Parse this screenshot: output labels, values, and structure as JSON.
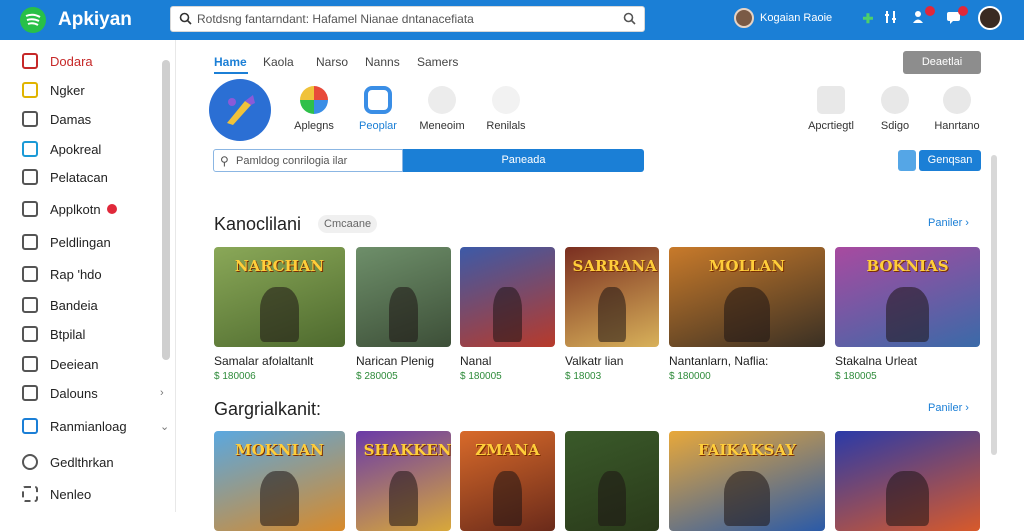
{
  "header": {
    "app_title": "Apkiyan",
    "search_placeholder": "Rotdsng fantarndant: Hafamel Nianae dntanacefiata",
    "user_name": "Kogaian Raoie",
    "icons": [
      "spotify-logo-icon",
      "search-icon",
      "plus-icon",
      "filter-icon",
      "notifications-icon",
      "messages-icon"
    ]
  },
  "sidebar": {
    "items": [
      {
        "label": "Dodara",
        "icon": "home-icon",
        "active": true
      },
      {
        "label": "Ngker",
        "icon": "star-icon"
      },
      {
        "label": "Damas",
        "icon": "list-icon"
      },
      {
        "label": "Apokreal",
        "icon": "app-icon"
      },
      {
        "label": "Pelatacan",
        "icon": "grid-icon"
      },
      {
        "label": "Applkotn",
        "icon": "tag-icon",
        "badge": true
      },
      {
        "label": "Peldlingan",
        "icon": "list-icon"
      },
      {
        "label": "Rap 'hdo",
        "icon": "folder-icon"
      },
      {
        "label": "Bandeia",
        "icon": "folder-icon"
      },
      {
        "label": "Btpilal",
        "icon": "folder-icon"
      },
      {
        "label": "Deeiean",
        "icon": "folder-icon"
      },
      {
        "label": "Dalouns",
        "icon": "stack-icon",
        "chevron": "›"
      },
      {
        "label": "Ranmianloag",
        "icon": "download-icon",
        "chevron": "⌄"
      },
      {
        "label": "Gedlthrkan",
        "icon": "clock-icon"
      },
      {
        "label": "Nenleo",
        "icon": "settings-icon"
      }
    ]
  },
  "tabs": [
    "Hame",
    "Kaola",
    "Narso",
    "Nanns",
    "Samers"
  ],
  "action_button": "Deaetlai",
  "categories_left": [
    {
      "label": "Aplegns",
      "color": "#e8a33b"
    },
    {
      "label": "Peoplar",
      "color": "#3a8ee6",
      "active": true
    },
    {
      "label": "Meneoim",
      "color": "#6d6d6d"
    },
    {
      "label": "Renilals",
      "color": "#5a6f8a"
    }
  ],
  "categories_right": [
    {
      "label": "Apcrtiegtl",
      "color": "#707070"
    },
    {
      "label": "Sdigo",
      "color": "#8a8a8a"
    },
    {
      "label": "Hanrtano",
      "color": "#8a8a8a"
    }
  ],
  "filter": {
    "placeholder": "Pamldog conrilogia ilar",
    "button_label": "Paneada",
    "right_button_label": "Genqsan"
  },
  "sections": [
    {
      "title": "Kanoclilani",
      "tag": "Cmcaane",
      "see_all": "Paniler ›",
      "cards": [
        {
          "title": "Samalar afolaltanlt",
          "price": "$ 180006",
          "art": "NARCHAN",
          "colors": [
            "#8aa858",
            "#4e6a2e"
          ]
        },
        {
          "title": "Narican Plenig",
          "price": "$ 280005",
          "art": "",
          "colors": [
            "#6e8f6a",
            "#3d4f38"
          ]
        },
        {
          "title": "Nanal",
          "price": "$ 180005",
          "art": "",
          "colors": [
            "#3c5aa8",
            "#b83a2a"
          ]
        },
        {
          "title": "Valkatr lian",
          "price": "$ 18003",
          "art": "SARRANA",
          "colors": [
            "#7a2e20",
            "#d8b15a"
          ]
        },
        {
          "title": "Nantanlarn, Naflia:",
          "price": "$ 180000",
          "art": "MOLLAN",
          "colors": [
            "#c87a2a",
            "#3a3024"
          ]
        },
        {
          "title": "Stakalna Urleat",
          "price": "$ 180005",
          "art": "BOKNIAS",
          "colors": [
            "#a84aa0",
            "#3a6aa8"
          ]
        }
      ]
    },
    {
      "title": "Gargrialkanit:",
      "see_all": "Paniler ›",
      "cards": [
        {
          "art": "MOKNIAN",
          "colors": [
            "#5aa8e0",
            "#d88a2a"
          ]
        },
        {
          "art": "SHAKKEN",
          "colors": [
            "#6a3aa8",
            "#d8a83a"
          ]
        },
        {
          "art": "ZMANA",
          "colors": [
            "#d86a2a",
            "#6a2a1a"
          ]
        },
        {
          "art": "",
          "colors": [
            "#3a5a2a",
            "#2a3a1a"
          ]
        },
        {
          "art": "FAIKAKSAY",
          "colors": [
            "#e8a83a",
            "#2a5aa8"
          ]
        },
        {
          "art": "",
          "colors": [
            "#2a3aa8",
            "#d85a2a"
          ]
        }
      ]
    }
  ],
  "theme": {
    "primary": "#1b7fd6",
    "active": "#c62828",
    "price": "#2e8b3a"
  }
}
